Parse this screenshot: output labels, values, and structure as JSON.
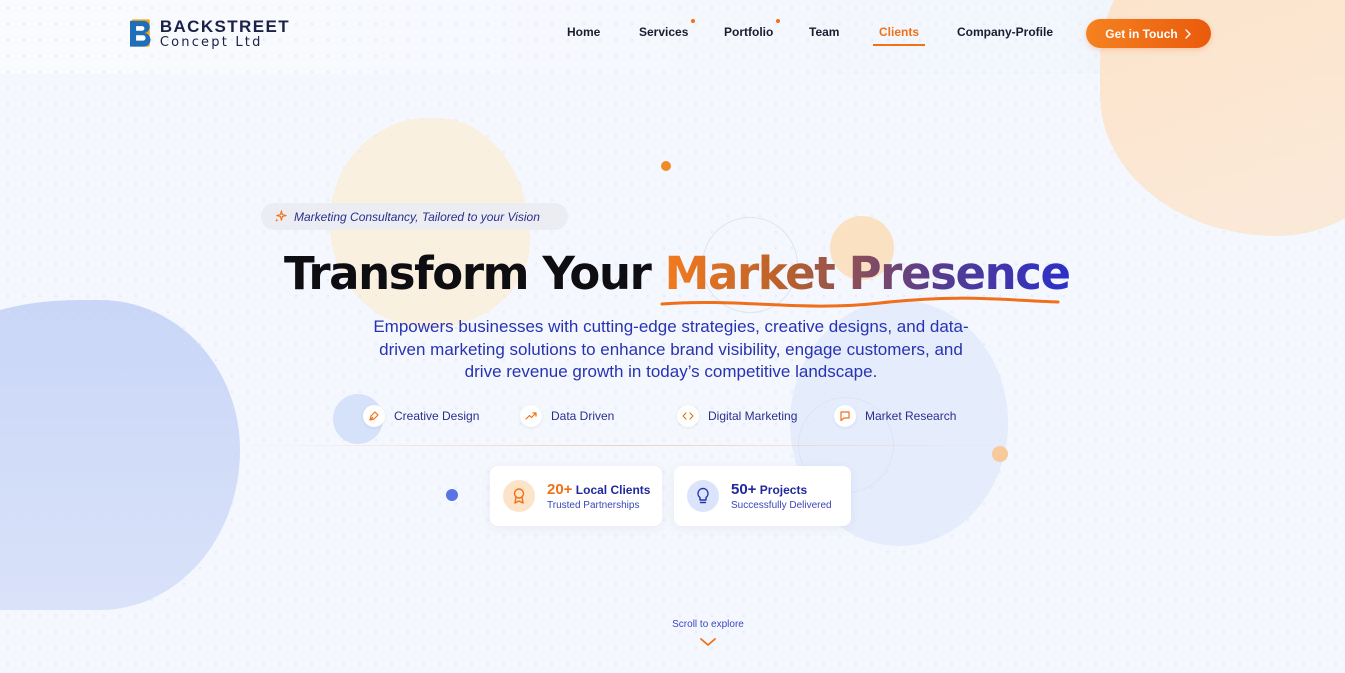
{
  "brand": {
    "name_line1": "BACKSTREET",
    "name_line2": "Concept Ltd",
    "logo_letter": "B"
  },
  "nav": {
    "items": [
      {
        "label": "Home",
        "active": false,
        "has_dot": false
      },
      {
        "label": "Services",
        "active": false,
        "has_dot": true
      },
      {
        "label": "Portfolio",
        "active": false,
        "has_dot": true
      },
      {
        "label": "Team",
        "active": false,
        "has_dot": false
      },
      {
        "label": "Clients",
        "active": true,
        "has_dot": false
      },
      {
        "label": "Company-Profile",
        "active": false,
        "has_dot": false
      }
    ],
    "cta_label": "Get in Touch",
    "cta_icon": "chevron-right-icon"
  },
  "hero": {
    "tagline": "Marketing Consultancy, Tailored to your Vision",
    "tagline_icon": "sparkles-icon",
    "title_plain": "Transform Your ",
    "title_highlight": "Market Presence",
    "subtitle": "Empowers businesses with cutting-edge strategies, creative designs, and data-driven marketing solutions to enhance brand visibility, engage customers, and drive revenue growth in today’s competitive landscape."
  },
  "features": [
    {
      "label": "Creative Design",
      "icon": "pen-tool-icon"
    },
    {
      "label": "Data Driven",
      "icon": "trending-up-icon"
    },
    {
      "label": "Digital Marketing",
      "icon": "code-icon"
    },
    {
      "label": "Market Research",
      "icon": "message-square-icon"
    }
  ],
  "stats": [
    {
      "number": "20+",
      "title": "Local Clients",
      "subtitle": "Trusted Partnerships",
      "icon": "award-icon"
    },
    {
      "number": "50+",
      "title": "Projects",
      "subtitle": "Successfully Delivered",
      "icon": "lightbulb-icon"
    }
  ],
  "scroll_label": "Scroll to explore",
  "colors": {
    "accent_orange": "#f07116",
    "brand_blue": "#2733b0",
    "text_dark": "#0d0d12"
  }
}
